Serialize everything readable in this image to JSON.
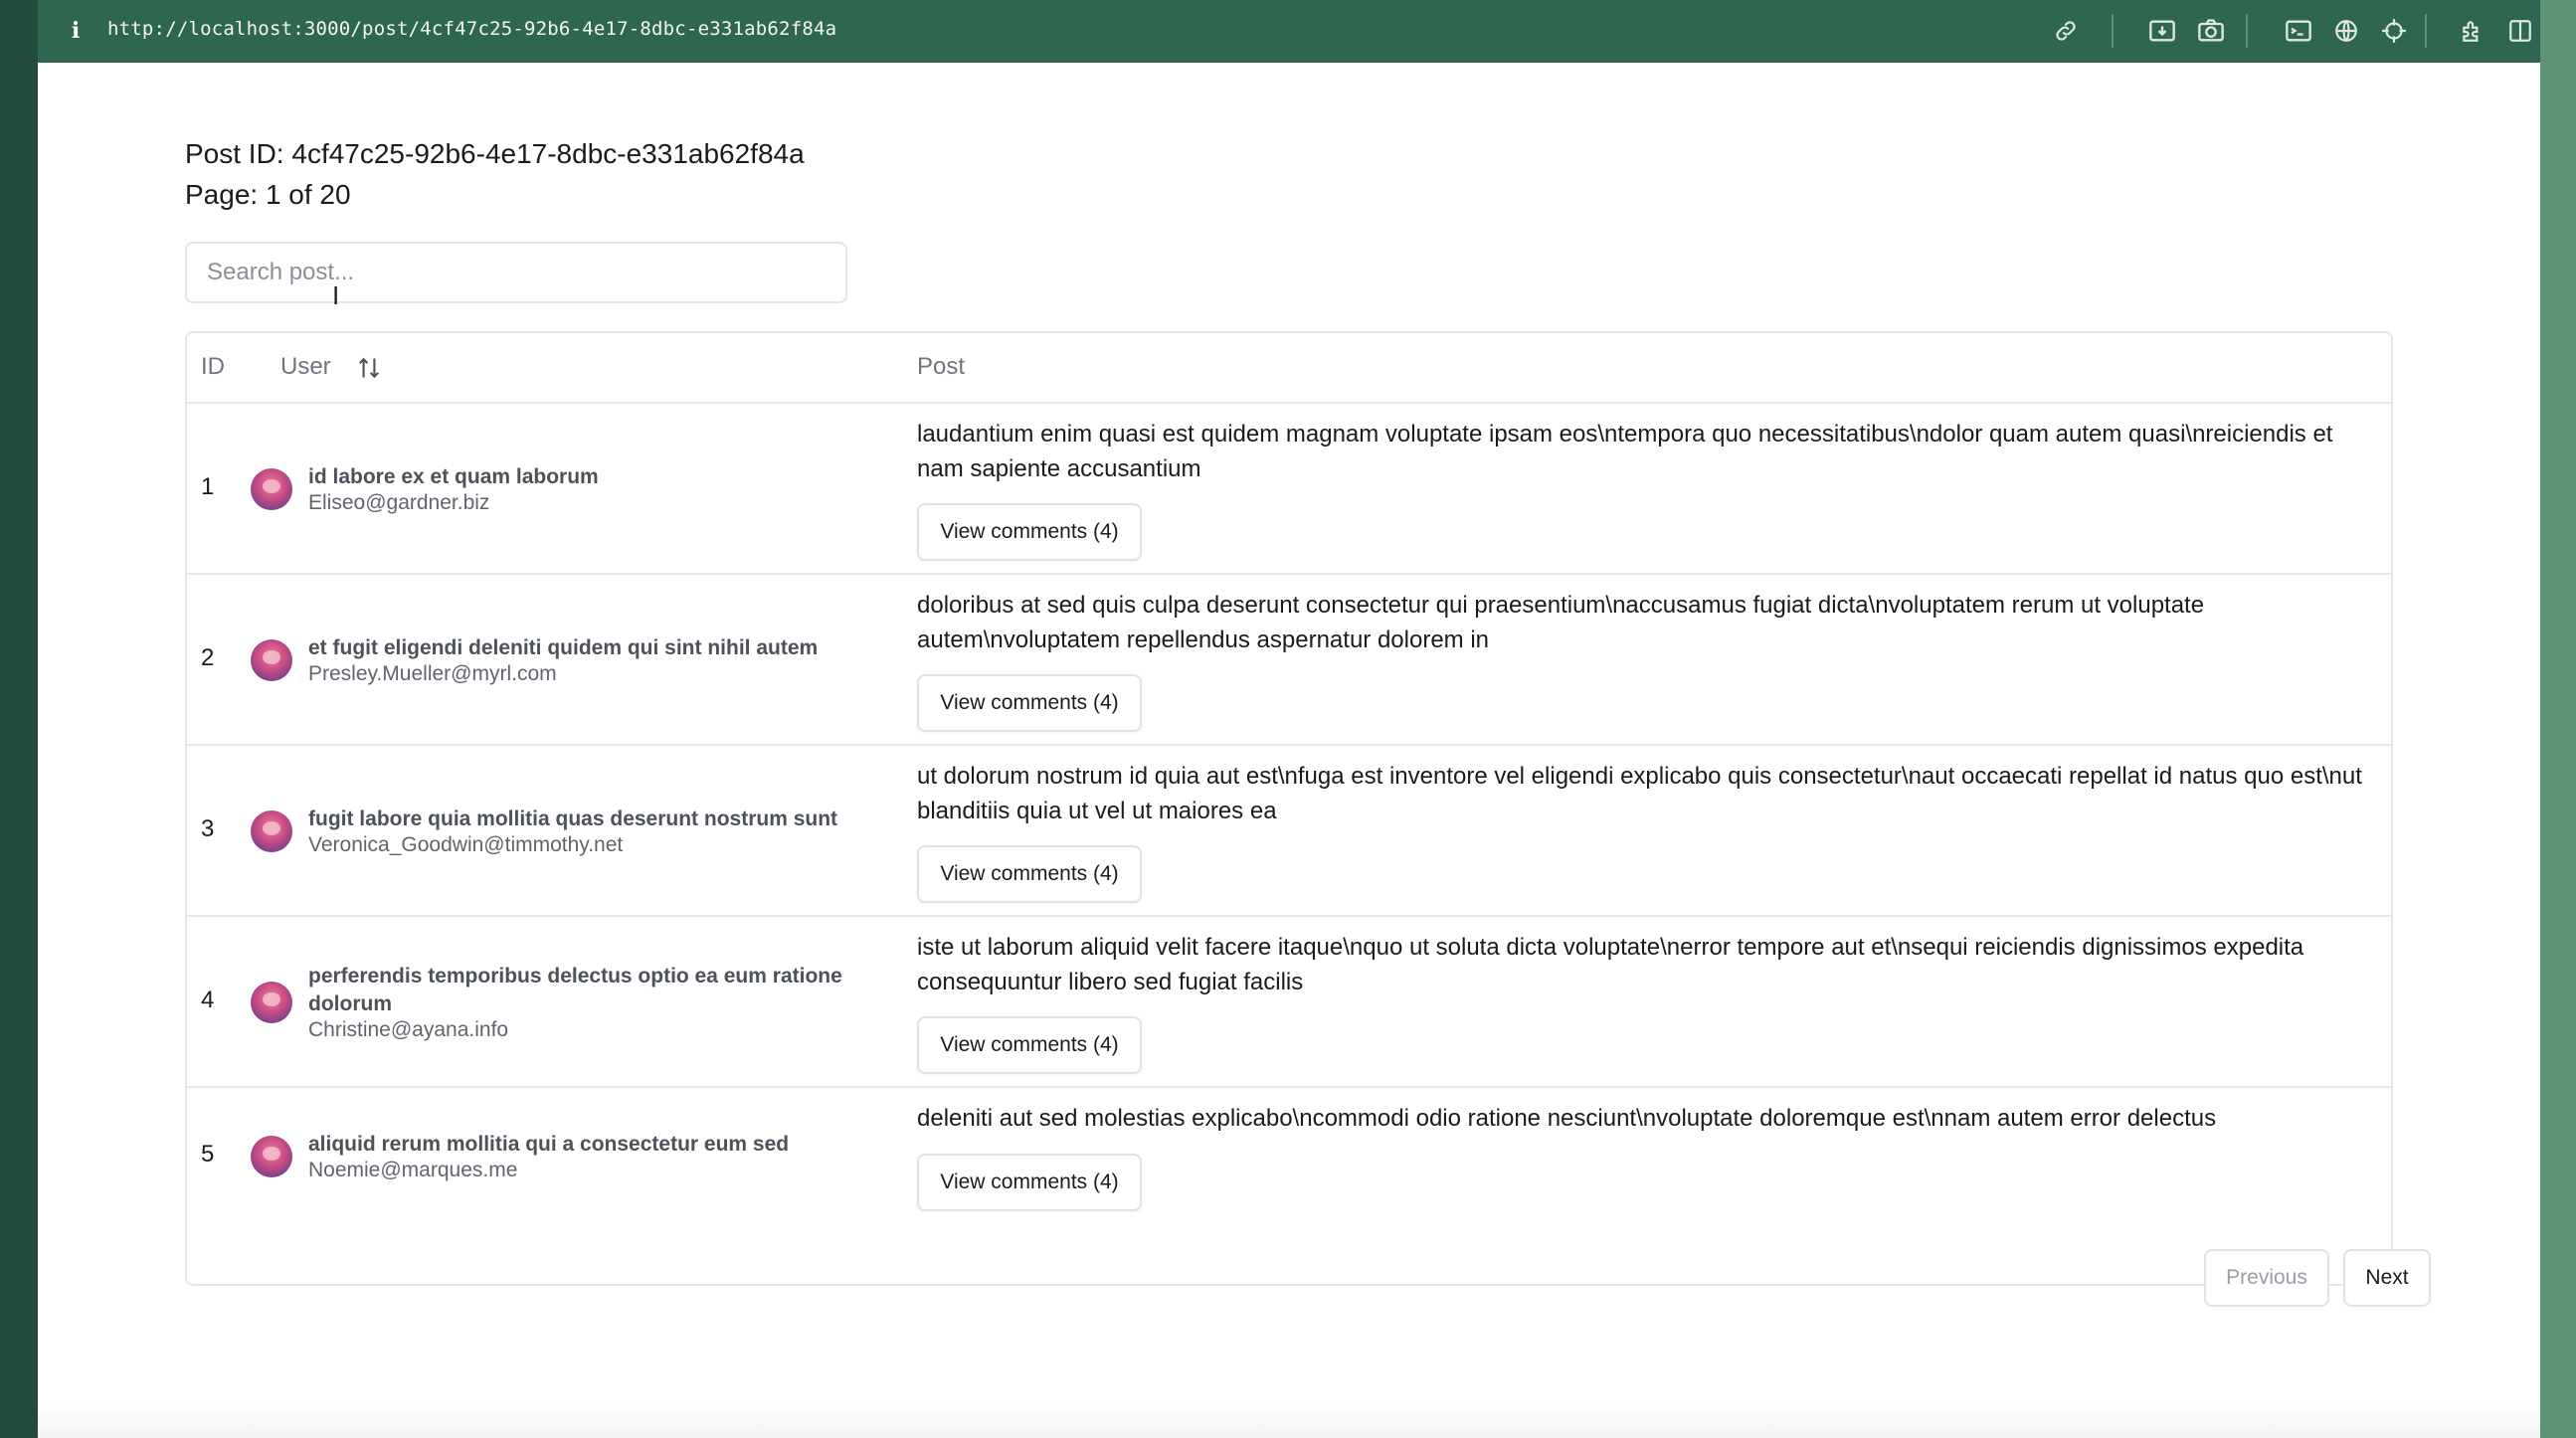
{
  "browser": {
    "url": "http://localhost:3000/post/4cf47c25-92b6-4e17-8dbc-e331ab62f84a",
    "info_icon": "i",
    "toolbar_icons": [
      "link-icon",
      "download-icon",
      "camera-icon",
      "terminal-icon",
      "globe-icon",
      "crosshair-icon",
      "extension-icon",
      "sidebar-icon"
    ]
  },
  "page": {
    "post_id": "Post ID: 4cf47c25-92b6-4e17-8dbc-e331ab62f84a",
    "page_info": "Page: 1 of 20",
    "search_placeholder": "Search post..."
  },
  "table": {
    "headers": {
      "id": "ID",
      "user": "User",
      "post": "Post"
    },
    "rows": [
      {
        "id": "1",
        "user_name": "id labore ex et quam laborum",
        "user_email": "Eliseo@gardner.biz",
        "post": "laudantium enim quasi est quidem magnam voluptate ipsam eos\\ntempora quo necessitatibus\\ndolor quam autem quasi\\nreiciendis et nam sapiente accusantium",
        "button": "View comments (4)"
      },
      {
        "id": "2",
        "user_name": "et fugit eligendi deleniti quidem qui sint nihil autem",
        "user_email": "Presley.Mueller@myrl.com",
        "post": "doloribus at sed quis culpa deserunt consectetur qui praesentium\\naccusamus fugiat dicta\\nvoluptatem rerum ut voluptate autem\\nvoluptatem repellendus aspernatur dolorem in",
        "button": "View comments (4)"
      },
      {
        "id": "3",
        "user_name": "fugit labore quia mollitia quas deserunt nostrum sunt",
        "user_email": "Veronica_Goodwin@timmothy.net",
        "post": "ut dolorum nostrum id quia aut est\\nfuga est inventore vel eligendi explicabo quis consectetur\\naut occaecati repellat id natus quo est\\nut blanditiis quia ut vel ut maiores ea",
        "button": "View comments (4)"
      },
      {
        "id": "4",
        "user_name": "perferendis temporibus delectus optio ea eum ratione dolorum",
        "user_email": "Christine@ayana.info",
        "post": "iste ut laborum aliquid velit facere itaque\\nquo ut soluta dicta voluptate\\nerror tempore aut et\\nsequi reiciendis dignissimos expedita consequuntur libero sed fugiat facilis",
        "button": "View comments (4)"
      },
      {
        "id": "5",
        "user_name": "aliquid rerum mollitia qui a consectetur eum sed",
        "user_email": "Noemie@marques.me",
        "post": "deleniti aut sed molestias explicabo\\ncommodi odio ratione nesciunt\\nvoluptate doloremque est\\nnam autem error delectus",
        "button": "View comments (4)"
      }
    ]
  },
  "pagination": {
    "previous": "Previous",
    "next": "Next"
  }
}
